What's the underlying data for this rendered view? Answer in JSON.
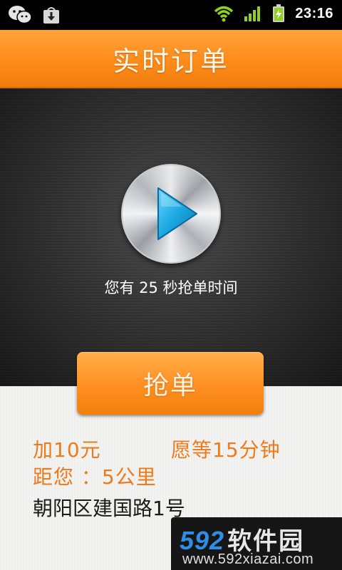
{
  "status_bar": {
    "time": "23:16",
    "icons": [
      "wechat-icon",
      "download-icon",
      "wifi-icon",
      "signal-icon",
      "battery-charging-icon"
    ]
  },
  "header": {
    "title": "实时订单"
  },
  "stage": {
    "play_icon": "play-icon",
    "countdown_text": "您有 25 秒抢单时间"
  },
  "grab_button": {
    "label": "抢单"
  },
  "order": {
    "bonus": "加10元",
    "wait": "愿等15分钟",
    "distance": "距您 ：5公里",
    "address": "朝阳区建国路1号"
  },
  "watermark": {
    "brand_digits": "592",
    "brand_cn": "软件园",
    "url": "www.592xiazai.com"
  },
  "colors": {
    "accent_orange": "#ff8c1a",
    "order_text_orange": "#ee7a1a",
    "stage_dark": "#2f2f2f",
    "play_blue": "#1aa8e0"
  }
}
